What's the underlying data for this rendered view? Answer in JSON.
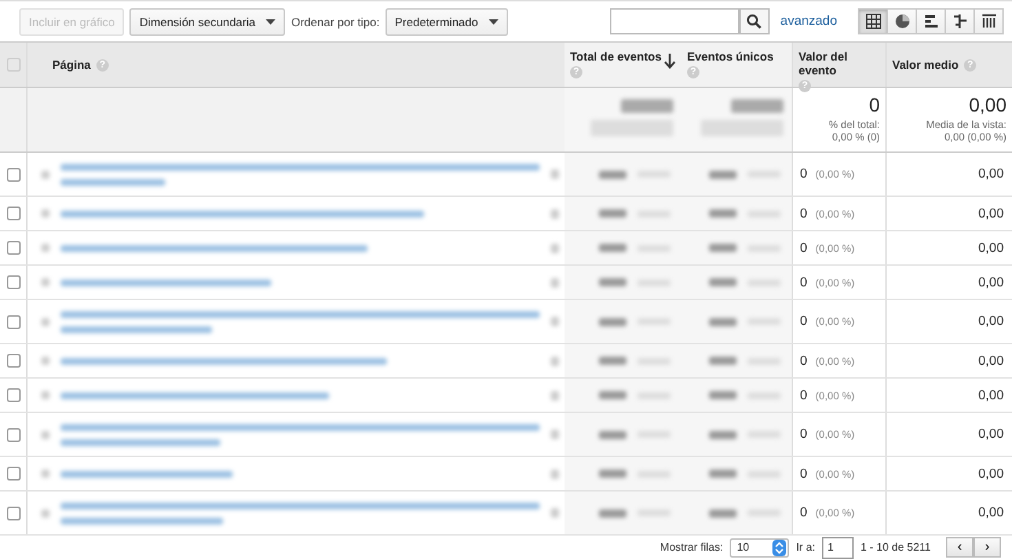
{
  "toolbar": {
    "chart_button": {
      "label": "Incluir en gráfico",
      "disabled": true
    },
    "secondary_dimension": "Dimensión secundaria",
    "sort_label": "Ordenar por tipo:",
    "sort_value": "Predeterminado",
    "advanced_link": "avanzado",
    "views": [
      {
        "kind": "table",
        "selected": true
      },
      {
        "kind": "pie",
        "selected": false
      },
      {
        "kind": "bars",
        "selected": false
      },
      {
        "kind": "comparison",
        "selected": false
      },
      {
        "kind": "pivot",
        "selected": false
      }
    ]
  },
  "table": {
    "columns": [
      {
        "label": "Página",
        "help": "?",
        "sorted": false
      },
      {
        "label": "Total de eventos",
        "help": "?",
        "sorted": true
      },
      {
        "label": "Eventos únicos",
        "help": "?",
        "sorted": false
      },
      {
        "label": "Valor del evento",
        "help": "?",
        "sorted": false
      },
      {
        "label": "Valor medio",
        "help": "?",
        "sorted": false
      }
    ],
    "header_checkbox": {
      "checked": false
    },
    "totals": {
      "event_value": "0",
      "event_value_note": "% del total:",
      "event_value_share": "0,00 % (0)",
      "avg_value": "0,00",
      "avg_value_note": "Media de la vista:",
      "avg_value_share": "0,00 (0,00 %)"
    },
    "rows": [
      {
        "checked": false,
        "page_wrap": true,
        "event_value": "0",
        "event_value_share": "(0,00 %)",
        "avg_value": "0,00"
      },
      {
        "checked": false,
        "page_wrap": false,
        "event_value": "0",
        "event_value_share": "(0,00 %)",
        "avg_value": "0,00"
      },
      {
        "checked": false,
        "page_wrap": false,
        "event_value": "0",
        "event_value_share": "(0,00 %)",
        "avg_value": "0,00"
      },
      {
        "checked": false,
        "page_wrap": false,
        "event_value": "0",
        "event_value_share": "(0,00 %)",
        "avg_value": "0,00"
      },
      {
        "checked": false,
        "page_wrap": true,
        "event_value": "0",
        "event_value_share": "(0,00 %)",
        "avg_value": "0,00"
      },
      {
        "checked": false,
        "page_wrap": false,
        "event_value": "0",
        "event_value_share": "(0,00 %)",
        "avg_value": "0,00"
      },
      {
        "checked": false,
        "page_wrap": false,
        "event_value": "0",
        "event_value_share": "(0,00 %)",
        "avg_value": "0,00"
      },
      {
        "checked": false,
        "page_wrap": true,
        "event_value": "0",
        "event_value_share": "(0,00 %)",
        "avg_value": "0,00"
      },
      {
        "checked": false,
        "page_wrap": false,
        "event_value": "0",
        "event_value_share": "(0,00 %)",
        "avg_value": "0,00"
      },
      {
        "checked": false,
        "page_wrap": true,
        "event_value": "0",
        "event_value_share": "(0,00 %)",
        "avg_value": "0,00"
      }
    ]
  },
  "pagination": {
    "rows_label": "Mostrar filas:",
    "rows_value": "10",
    "goto_label": "Ir a:",
    "goto_value": "1",
    "range": "1 - 10 de 5211",
    "prev": "‹",
    "next": "›"
  }
}
